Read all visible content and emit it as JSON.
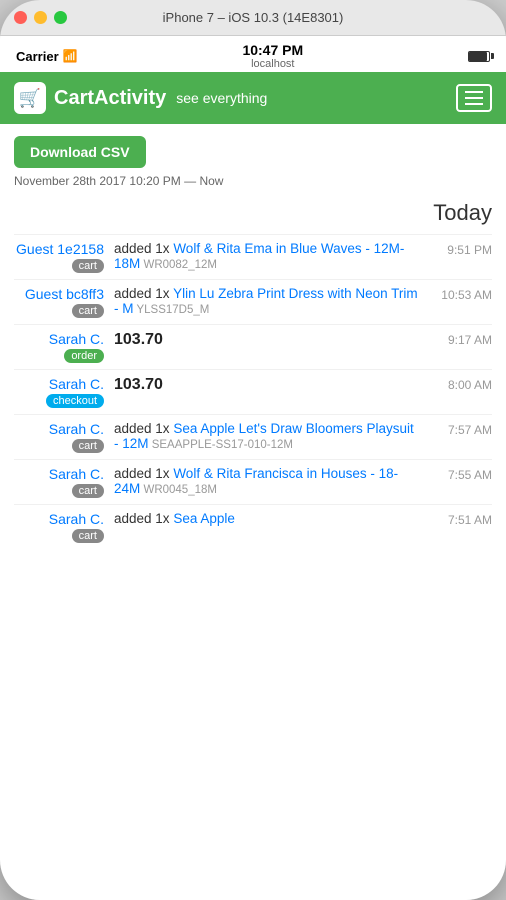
{
  "window": {
    "title": "iPhone 7 – iOS 10.3 (14E8301)"
  },
  "status_bar": {
    "carrier": "Carrier",
    "time": "10:47 PM",
    "url": "localhost"
  },
  "header": {
    "logo_emoji": "🛒",
    "app_name": "CartActivity",
    "tagline": "see everything",
    "hamburger_label": "☰"
  },
  "content": {
    "download_btn": "Download CSV",
    "date_range": "November 28th 2017 10:20 PM — Now",
    "section_today": "Today",
    "activities": [
      {
        "user": "Guest 1e2158",
        "badge": "cart",
        "badge_type": "cart",
        "time": "9:51 PM",
        "description": "added 1x",
        "product_link": "Wolf & Rita Ema in Blue Waves - 12M-18M",
        "sku": "WR0082_12M",
        "amount": null
      },
      {
        "user": "Guest bc8ff3",
        "badge": "cart",
        "badge_type": "cart",
        "time": "10:53 AM",
        "description": "added 1x",
        "product_link": "Ylin Lu Zebra Print Dress with Neon Trim - M",
        "sku": "YLSS17D5_M",
        "amount": null
      },
      {
        "user": "Sarah C.",
        "badge": "order",
        "badge_type": "order",
        "time": "9:17 AM",
        "description": null,
        "product_link": null,
        "sku": null,
        "amount": "103.70"
      },
      {
        "user": "Sarah C.",
        "badge": "checkout",
        "badge_type": "checkout",
        "time": "8:00 AM",
        "description": null,
        "product_link": null,
        "sku": null,
        "amount": "103.70"
      },
      {
        "user": "Sarah C.",
        "badge": "cart",
        "badge_type": "cart",
        "time": "7:57 AM",
        "description": "added 1x",
        "product_link": "Sea Apple Let's Draw Bloomers Playsuit - 12M",
        "sku": "SEAAPPLE-SS17-010-12M",
        "amount": null
      },
      {
        "user": "Sarah C.",
        "badge": "cart",
        "badge_type": "cart",
        "time": "7:55 AM",
        "description": "added 1x",
        "product_link": "Wolf & Rita Francisca in Houses - 18-24M",
        "sku": "WR0045_18M",
        "amount": null
      },
      {
        "user": "Sarah C.",
        "badge": "cart",
        "badge_type": "cart",
        "time": "7:51 AM",
        "description": "added 1x",
        "product_link": "Sea Apple",
        "sku": "",
        "amount": null,
        "partial": true
      }
    ]
  }
}
